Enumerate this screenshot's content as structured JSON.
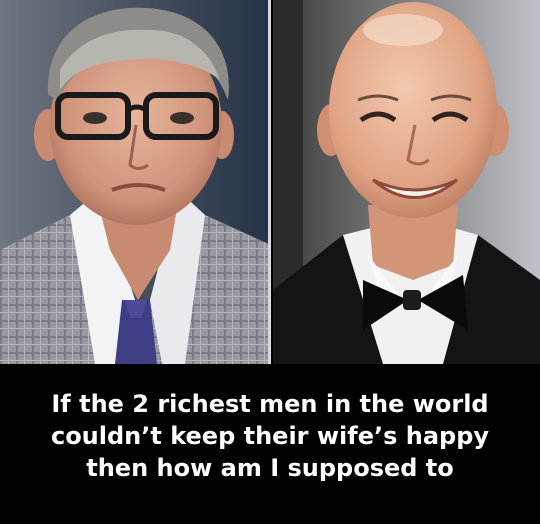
{
  "caption": {
    "line1": "If the 2 richest men in the world",
    "line2": "couldn’t keep their wife’s happy",
    "line3": "then how am I supposed to"
  }
}
